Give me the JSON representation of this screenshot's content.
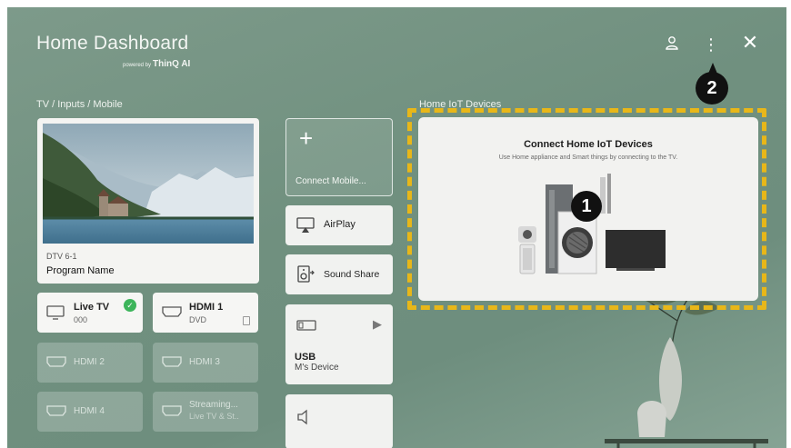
{
  "header": {
    "title": "Home Dashboard",
    "powered_prefix": "powered by",
    "powered_brand": "ThinQ AI"
  },
  "callouts": {
    "one": "1",
    "two": "2"
  },
  "left": {
    "section_label": "TV / Inputs / Mobile",
    "program": {
      "channel": "DTV 6-1",
      "name": "Program Name"
    },
    "tiles": [
      {
        "label": "Live TV",
        "sub": "000"
      },
      {
        "label": "HDMI 1",
        "sub": "DVD"
      },
      {
        "label": "HDMI 2"
      },
      {
        "label": "HDMI 3"
      },
      {
        "label": "HDMI 4"
      },
      {
        "label": "Streaming...",
        "sub": "Live TV & St.."
      }
    ]
  },
  "middle": {
    "connect_label": "Connect Mobile...",
    "airplay": "AirPlay",
    "sound_share": "Sound Share",
    "usb_label": "USB",
    "usb_sub": "M's Device"
  },
  "iot": {
    "section_label": "Home IoT Devices",
    "title": "Connect Home IoT Devices",
    "subtitle": "Use Home appliance and Smart things by connecting to the TV."
  },
  "colors": {
    "background": "#70907f",
    "highlight_dash": "#e8b719",
    "check_green": "#3db55b"
  }
}
